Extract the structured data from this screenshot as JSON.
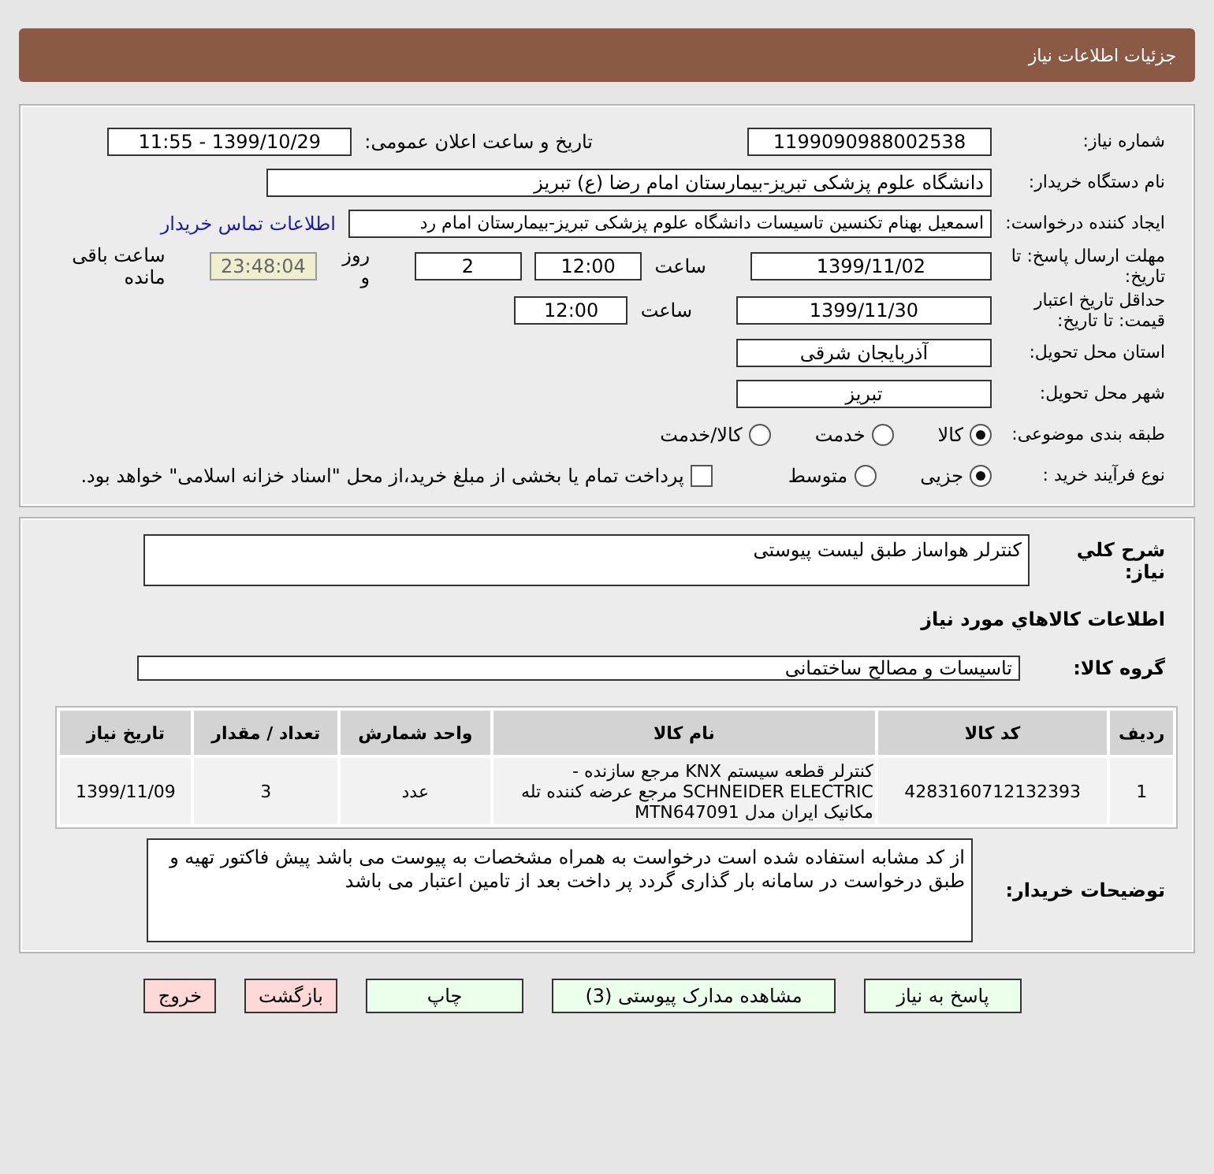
{
  "header": {
    "title": "جزئیات اطلاعات نیاز"
  },
  "details": {
    "rows": [
      {
        "label": "شماره نیاز:",
        "items": [
          {
            "kind": "medium",
            "value": "1199090988002538"
          },
          {
            "kind": "caption",
            "text": "تاریخ و ساعت اعلان عمومی:"
          },
          {
            "kind": "medium",
            "value": "1399/10/29 - 11:55"
          }
        ]
      },
      {
        "label": "نام دستگاه خریدار:",
        "items": [
          {
            "kind": "wide",
            "value": "دانشگاه علوم پزشکی تبریز-بیمارستان امام رضا (ع) تبریز"
          }
        ]
      },
      {
        "label": "ایجاد کننده درخواست:",
        "items": [
          {
            "kind": "long",
            "value": "اسمعیل بهنام تکنسین تاسیسات دانشگاه علوم پزشکی تبریز-بیمارستان امام رد"
          },
          {
            "kind": "link",
            "text": "اطلاعات تماس خریدار"
          }
        ]
      },
      {
        "label": "مهلت ارسال پاسخ: تا تاریخ:",
        "items": [
          {
            "kind": "date",
            "value": "1399/11/02"
          },
          {
            "kind": "text",
            "text": "ساعت"
          },
          {
            "kind": "short",
            "value": "12:00"
          },
          {
            "kind": "short",
            "value": "2"
          },
          {
            "kind": "text",
            "text": "روز و"
          },
          {
            "kind": "timer",
            "value": "23:48:04"
          },
          {
            "kind": "text",
            "text": "ساعت باقی مانده"
          }
        ]
      },
      {
        "label": "حداقل تاریخ اعتبار قیمت: تا تاریخ:",
        "items": [
          {
            "kind": "date",
            "value": "1399/11/30"
          },
          {
            "kind": "text",
            "text": "ساعت"
          },
          {
            "kind": "short",
            "value": "12:00"
          }
        ]
      },
      {
        "label": "استان محل تحویل:",
        "items": [
          {
            "kind": "date",
            "value": "آذربایجان شرقی"
          }
        ]
      },
      {
        "label": "شهر محل تحویل:",
        "items": [
          {
            "kind": "date",
            "value": "تبریز"
          }
        ]
      },
      {
        "label": "طبقه بندی موضوعی:",
        "items": [
          {
            "kind": "radio",
            "text": "کالا",
            "selected": true
          },
          {
            "kind": "radio",
            "text": "خدمت",
            "selected": false
          },
          {
            "kind": "radio",
            "text": "کالا/خدمت",
            "selected": false
          }
        ]
      },
      {
        "label": "نوع فرآیند خرید :",
        "items": [
          {
            "kind": "radio",
            "text": "جزیی",
            "selected": true
          },
          {
            "kind": "radio",
            "text": "متوسط",
            "selected": false
          },
          {
            "kind": "checkbox",
            "text": "پرداخت تمام یا بخشی از مبلغ خرید،از محل \"اسناد خزانه اسلامی\" خواهد بود.",
            "checked": false
          }
        ]
      }
    ]
  },
  "need": {
    "summary_label": "شرح کلي نياز:",
    "summary": "کنترلر هواساز طبق لیست پیوستی",
    "goods_heading": "اطلاعات کالاهاي مورد نياز",
    "group_label": "گروه کالا:",
    "group": "تاسیسات و مصالح ساختمانی",
    "table": {
      "columns": [
        "ردیف",
        "کد کالا",
        "نام کالا",
        "واحد شمارش",
        "تعداد / مقدار",
        "تاریخ نیاز"
      ],
      "rows": [
        [
          "1",
          "4283160712132393",
          "کنترلر قطعه سیستم KNX مرجع سازنده -SCHNEIDER ELECTRIC مرجع عرضه کننده تله مکانیک ایران مدل MTN647091",
          "عدد",
          "3",
          "1399/11/09"
        ]
      ]
    },
    "notes_label": "توضیحات خریدار:",
    "notes": "از کد مشابه استفاده شده است درخواست به همراه مشخصات به پیوست می باشد پیش فاکتور تهیه و طبق درخواست در سامانه بار گذاری گردد پر داخت بعد از تامین اعتبار می باشد"
  },
  "buttons": [
    {
      "label": "پاسخ به نیاز",
      "kind": "primary"
    },
    {
      "label": "مشاهده مدارک پیوستی (3)",
      "kind": "primary"
    },
    {
      "label": "چاپ",
      "kind": "primary"
    },
    {
      "label": "بازگشت",
      "kind": "danger"
    },
    {
      "label": "خروج",
      "kind": "danger"
    }
  ]
}
